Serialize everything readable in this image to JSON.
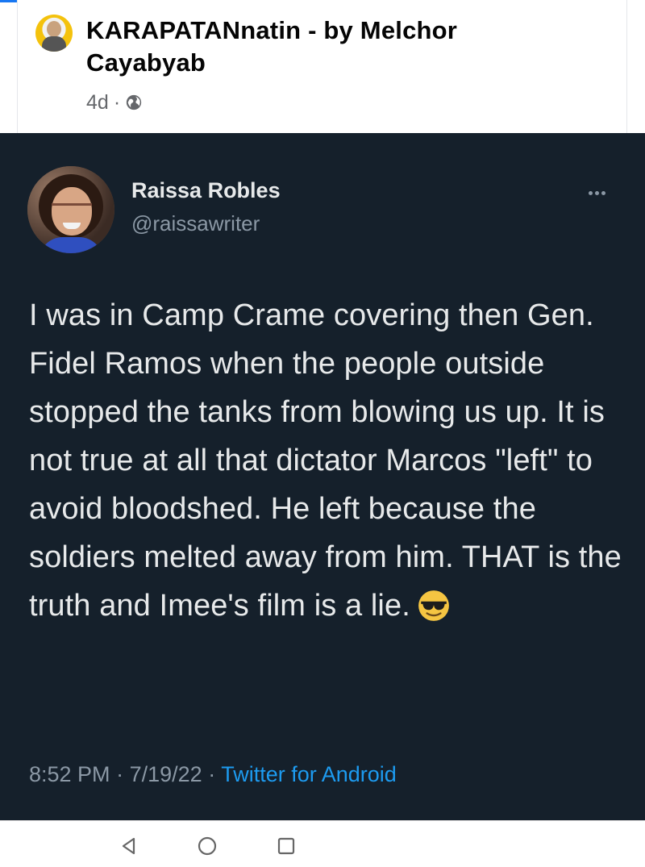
{
  "facebook_post": {
    "page_name": "KARAPATANnatin - by Melchor Cayabyab",
    "time": "4d",
    "separator": "·",
    "privacy_icon": "globe-icon"
  },
  "tweet": {
    "display_name": "Raissa Robles",
    "handle": "@raissawriter",
    "text": "I was in Camp Crame covering then Gen. Fidel Ramos when the people outside stopped the tanks from blowing us up. It is not true at all that dictator Marcos \"left\" to avoid bloodshed. He left because the soldiers melted away from him. THAT is the truth and Imee's film is a lie.",
    "emoji": "sunglasses-emoji-icon",
    "time": "8:52 PM",
    "sep1": "·",
    "date": "7/19/22",
    "sep2": "·",
    "source": "Twitter for Android",
    "more_icon": "more-options-icon"
  },
  "nav_bar": {
    "icons": [
      "back-triangle-icon",
      "home-circle-icon",
      "recents-square-icon"
    ]
  },
  "colors": {
    "tweet_bg": "#15202b",
    "link": "#1d9bf0",
    "secondary": "#8b98a5",
    "fb_blue": "#1877f2"
  }
}
